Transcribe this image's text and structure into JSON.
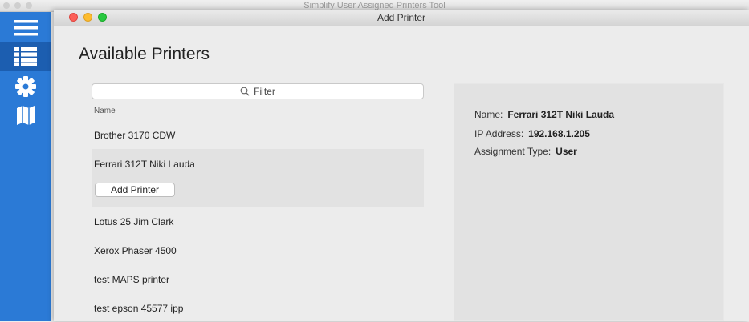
{
  "parent_window": {
    "title": "Simplify User Assigned Printers Tool"
  },
  "sidebar": {
    "items": [
      {
        "icon": "hamburger-menu-icon"
      },
      {
        "icon": "list-icon",
        "active": true
      },
      {
        "icon": "gear-icon"
      },
      {
        "icon": "map-icon"
      }
    ],
    "color": "#2b7ad6"
  },
  "sheet": {
    "title": "Add Printer",
    "heading": "Available Printers",
    "filter": {
      "placeholder": "Filter",
      "icon": "search-icon"
    },
    "list": {
      "column_header": "Name",
      "rows": [
        {
          "name": "Brother 3170 CDW"
        },
        {
          "name": "Ferrari 312T Niki Lauda",
          "selected": true,
          "button_label": "Add Printer"
        },
        {
          "name": "Lotus 25 Jim Clark"
        },
        {
          "name": "Xerox Phaser 4500"
        },
        {
          "name": "test MAPS printer"
        },
        {
          "name": "test epson 45577 ipp"
        }
      ]
    },
    "details": {
      "name_label": "Name:",
      "name_value": "Ferrari 312T Niki Lauda",
      "ip_label": "IP Address:",
      "ip_value": "192.168.1.205",
      "type_label": "Assignment Type:",
      "type_value": "User"
    }
  }
}
